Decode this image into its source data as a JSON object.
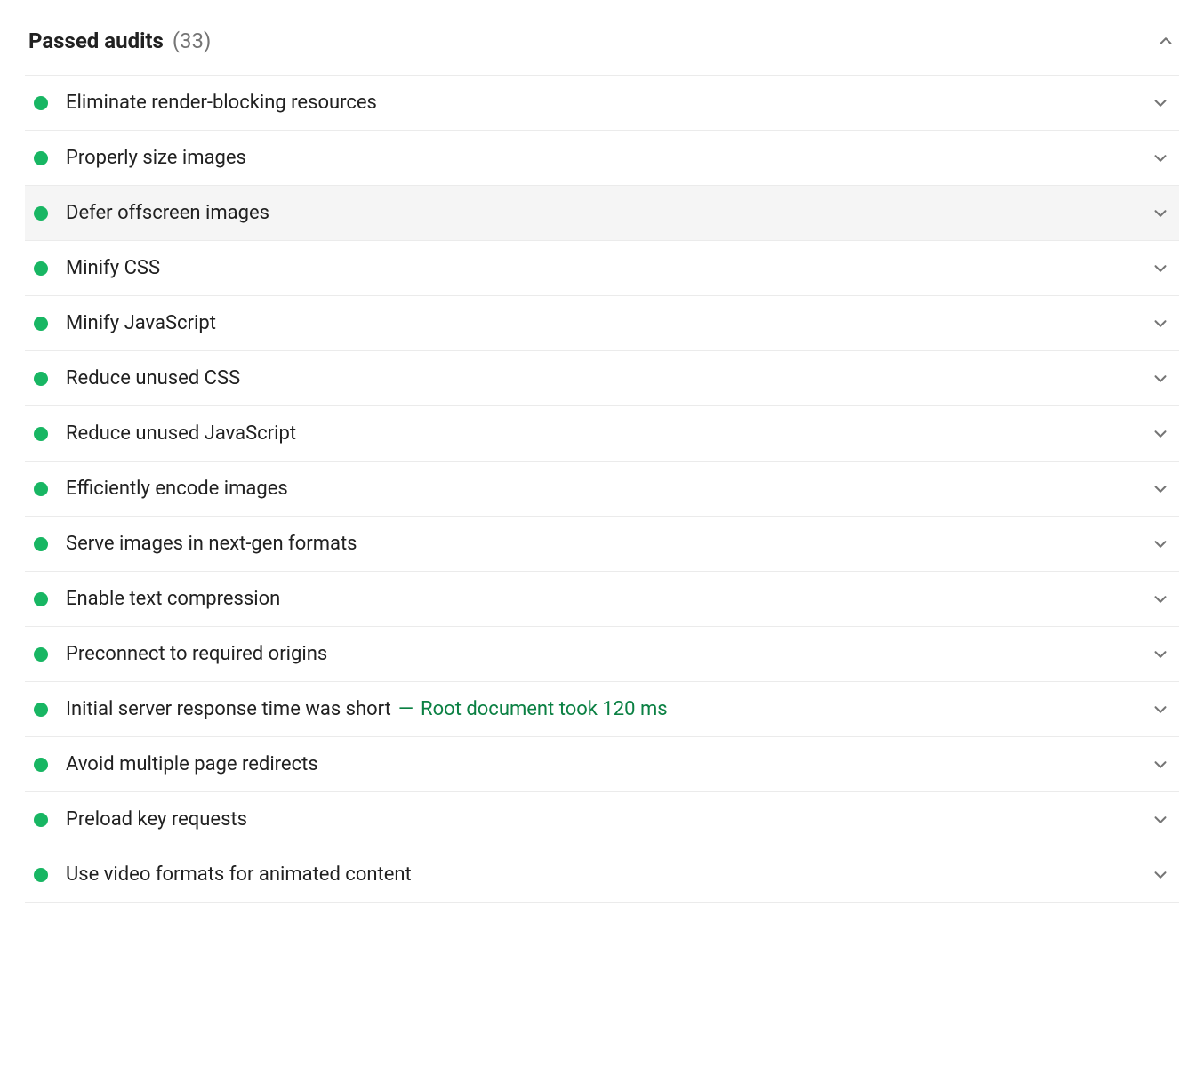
{
  "section": {
    "title": "Passed audits",
    "count": "(33)"
  },
  "audits": [
    {
      "label": "Eliminate render-blocking resources",
      "detail": null,
      "hovered": false
    },
    {
      "label": "Properly size images",
      "detail": null,
      "hovered": false
    },
    {
      "label": "Defer offscreen images",
      "detail": null,
      "hovered": true
    },
    {
      "label": "Minify CSS",
      "detail": null,
      "hovered": false
    },
    {
      "label": "Minify JavaScript",
      "detail": null,
      "hovered": false
    },
    {
      "label": "Reduce unused CSS",
      "detail": null,
      "hovered": false
    },
    {
      "label": "Reduce unused JavaScript",
      "detail": null,
      "hovered": false
    },
    {
      "label": "Efficiently encode images",
      "detail": null,
      "hovered": false
    },
    {
      "label": "Serve images in next-gen formats",
      "detail": null,
      "hovered": false
    },
    {
      "label": "Enable text compression",
      "detail": null,
      "hovered": false
    },
    {
      "label": "Preconnect to required origins",
      "detail": null,
      "hovered": false
    },
    {
      "label": "Initial server response time was short",
      "detail": "Root document took 120 ms",
      "hovered": false
    },
    {
      "label": "Avoid multiple page redirects",
      "detail": null,
      "hovered": false
    },
    {
      "label": "Preload key requests",
      "detail": null,
      "hovered": false
    },
    {
      "label": "Use video formats for animated content",
      "detail": null,
      "hovered": false
    }
  ],
  "colors": {
    "pass": "#18b663",
    "detail": "#0b8043",
    "muted": "#757575",
    "border": "#ebebeb"
  }
}
